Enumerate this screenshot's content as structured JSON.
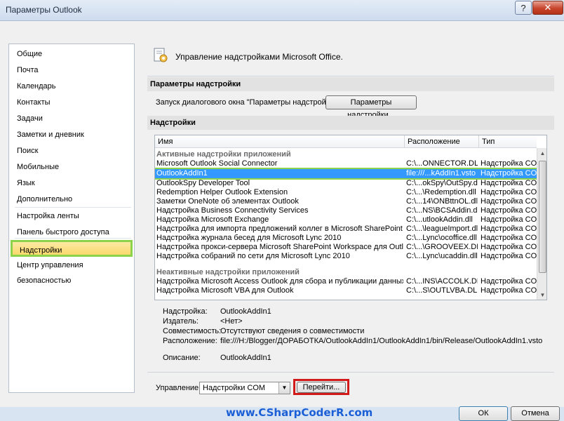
{
  "window": {
    "title": "Параметры Outlook",
    "help_glyph": "?",
    "close_glyph": "✕"
  },
  "nav": {
    "items": [
      {
        "label": "Общие"
      },
      {
        "label": "Почта"
      },
      {
        "label": "Календарь"
      },
      {
        "label": "Контакты"
      },
      {
        "label": "Задачи"
      },
      {
        "label": "Заметки и дневник"
      },
      {
        "label": "Поиск"
      },
      {
        "label": "Мобильные"
      },
      {
        "label": "Язык"
      },
      {
        "label": "Дополнительно"
      },
      {
        "label": "Настройка ленты"
      },
      {
        "label": "Панель быстрого доступа"
      },
      {
        "label": "Надстройки"
      },
      {
        "label": "Центр управления безопасностью"
      }
    ],
    "selected": "Надстройки"
  },
  "main": {
    "header_title": "Управление надстройками Microsoft Office.",
    "section_params": "Параметры надстройки",
    "launch_label": "Запуск диалогового окна \"Параметры надстройки\":",
    "params_button": "Параметры надстройки...",
    "section_addins": "Надстройки",
    "table": {
      "columns": {
        "name": "Имя",
        "location": "Расположение",
        "type": "Тип"
      },
      "active_title": "Активные надстройки приложений",
      "active_rows": [
        {
          "name": "Microsoft Outlook Social Connector",
          "location": "C:\\...ONNECTOR.DLL",
          "type": "Надстройка COM"
        },
        {
          "name": "OutlookAddIn1",
          "location": "file:///...kAddIn1.vsto",
          "type": "Надстройка COM"
        },
        {
          "name": "OutlookSpy Developer Tool",
          "location": "C:\\...okSpy\\OutSpy.dll",
          "type": "Надстройка COM"
        },
        {
          "name": "Redemption Helper Outlook Extension",
          "location": "C:\\...\\Redemption.dll",
          "type": "Надстройка COM"
        },
        {
          "name": "Заметки OneNote об элементах Outlook",
          "location": "C:\\...14\\ONBttnOL.dll",
          "type": "Надстройка COM"
        },
        {
          "name": "Надстройка Business Connectivity Services",
          "location": "C:\\...NS\\BCSAddin.dll",
          "type": "Надстройка COM"
        },
        {
          "name": "Надстройка Microsoft Exchange",
          "location": "C:\\...utlookAddin.dll",
          "type": "Надстройка COM"
        },
        {
          "name": "Надстройка для импорта предложений коллег в Microsoft SharePoint Server",
          "location": "C:\\...\\leagueImport.dll",
          "type": "Надстройка COM"
        },
        {
          "name": "Надстройка журнала бесед для Microsoft Lync 2010",
          "location": "C:\\...Lync\\ocoffice.dll",
          "type": "Надстройка COM"
        },
        {
          "name": "Надстройка прокси-сервера Microsoft SharePoint Workspace для Outlook",
          "location": "C:\\...\\GROOVEEX.DLL",
          "type": "Надстройка COM"
        },
        {
          "name": "Надстройка собраний по сети для Microsoft Lync 2010",
          "location": "C:\\...Lync\\ucaddin.dll",
          "type": "Надстройка COM"
        }
      ],
      "selected_row": "OutlookAddIn1",
      "inactive_title": "Неактивные надстройки приложений",
      "inactive_rows": [
        {
          "name": "Надстройка Microsoft Access Outlook для сбора и публикации данных",
          "location": "C:\\...INS\\ACCOLK.DLL",
          "type": "Надстройка COM"
        },
        {
          "name": "Надстройка Microsoft VBA для Outlook",
          "location": "C:\\...S\\OUTLVBA.DLL",
          "type": "Надстройка COM"
        }
      ]
    },
    "details": {
      "addin_label": "Надстройка:",
      "addin_value": "OutlookAddIn1",
      "publisher_label": "Издатель:",
      "publisher_value": "<Нет>",
      "compat_label": "Совместимость:",
      "compat_value": "Отсутствуют сведения о совместимости",
      "location_label": "Расположение:",
      "location_value": "file:///H:/Blogger/ДОРАБОТКА/OutlookAddIn1/OutlookAddIn1/bin/Release/OutlookAddIn1.vsto",
      "desc_label": "Описание:",
      "desc_value": "OutlookAddIn1"
    },
    "manage": {
      "label": "Управление:",
      "selected": "Надстройки COM",
      "go_button": "Перейти..."
    }
  },
  "footer": {
    "watermark": "www.CSharpCoderR.com",
    "ok": "ОК",
    "cancel": "Отмена"
  },
  "colors": {
    "selection": "#3399ff",
    "highlight_green": "#8cd24b",
    "highlight_red": "#d21a1a",
    "watermark": "#1a5fd6"
  },
  "icons": {
    "addins_header": "gear-document-icon",
    "dropdown": "chevron-down-icon",
    "scroll_up": "arrow-up-icon",
    "scroll_down": "arrow-down-icon"
  }
}
